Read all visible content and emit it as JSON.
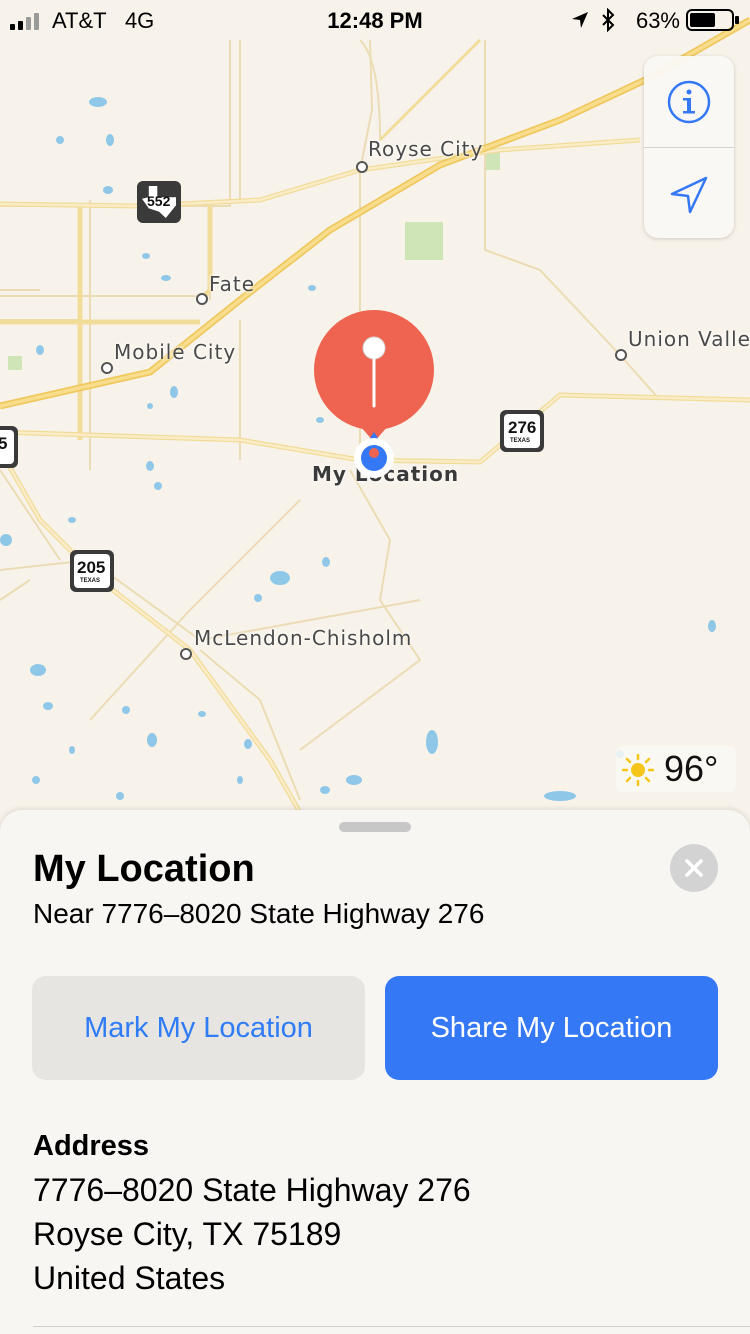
{
  "status_bar": {
    "carrier": "AT&T",
    "network": "4G",
    "time": "12:48 PM",
    "battery_percent": "63%",
    "battery_level": 0.63
  },
  "map": {
    "places": {
      "royse_city": "Royse City",
      "fate": "Fate",
      "mobile_city": "Mobile City",
      "union_valley": "Union Valle",
      "my_location": "My Location",
      "mclendon": "McLendon-Chisholm"
    },
    "shields": {
      "tx552": "552",
      "tx276": "276",
      "tx205": "205",
      "tx205_sub": "TEXAS",
      "tx276_sub": "TEXAS",
      "left_edge": "5"
    },
    "weather": {
      "temperature": "96°",
      "icon": "sun-icon"
    },
    "controls": {
      "info_icon": "info-icon",
      "location_icon": "location-arrow-icon"
    },
    "colors": {
      "pin": "#ef6450",
      "user_dot": "#3478f6",
      "road_major": "#f5d36b",
      "water": "#8fc7e8"
    }
  },
  "sheet": {
    "title": "My Location",
    "subtitle": "Near 7776–8020 State Highway 276",
    "mark_button": "Mark My Location",
    "share_button": "Share My Location",
    "address_heading": "Address",
    "address_lines": [
      "7776–8020 State Highway 276",
      "Royse City, TX  75189",
      "United States"
    ],
    "colors": {
      "accent": "#3478f6"
    }
  }
}
